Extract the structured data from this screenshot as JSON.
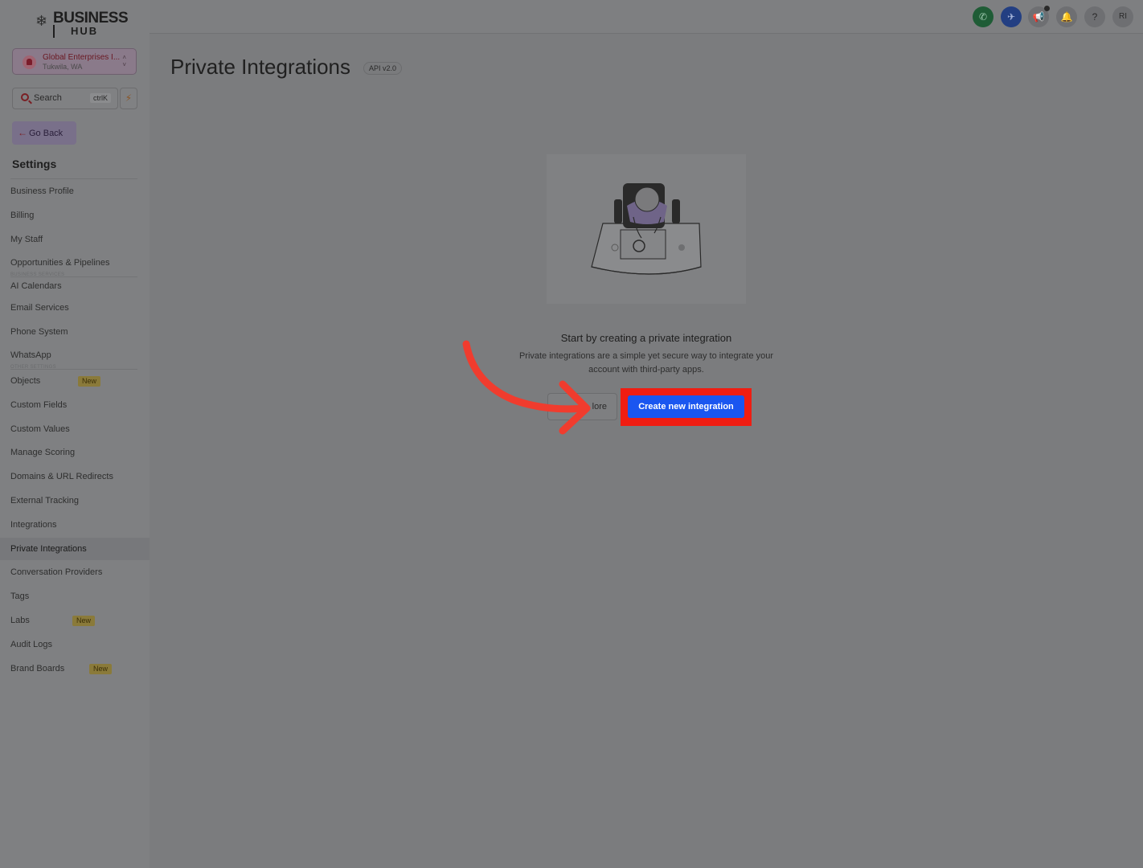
{
  "brand": {
    "line1": "BUSINESS",
    "line2": "HUB"
  },
  "account": {
    "name": "Global Enterprises I...",
    "location": "Tukwila, WA"
  },
  "search": {
    "label": "Search",
    "shortcut": "ctrlK"
  },
  "go_back": "Go Back",
  "settings_title": "Settings",
  "sections": {
    "business_services": "BUSINESS SERVICES",
    "other_settings": "OTHER SETTINGS"
  },
  "nav": [
    {
      "label": "Business Profile"
    },
    {
      "label": "Billing"
    },
    {
      "label": "My Staff"
    },
    {
      "label": "Opportunities & Pipelines"
    },
    {
      "label": "AI Calendars"
    },
    {
      "label": "Email Services"
    },
    {
      "label": "Phone System"
    },
    {
      "label": "WhatsApp"
    },
    {
      "label": "Objects",
      "badge": "New"
    },
    {
      "label": "Custom Fields"
    },
    {
      "label": "Custom Values"
    },
    {
      "label": "Manage Scoring"
    },
    {
      "label": "Domains & URL Redirects"
    },
    {
      "label": "External Tracking"
    },
    {
      "label": "Integrations"
    },
    {
      "label": "Private Integrations",
      "active": true
    },
    {
      "label": "Conversation Providers"
    },
    {
      "label": "Tags"
    },
    {
      "label": "Labs",
      "badge": "New"
    },
    {
      "label": "Audit Logs"
    },
    {
      "label": "Brand Boards",
      "badge": "New"
    }
  ],
  "topbar": {
    "avatar_initials": "RI",
    "help": "?"
  },
  "page": {
    "title": "Private Integrations",
    "api_badge": "API v2.0",
    "empty_title": "Start by creating a private integration",
    "empty_desc": "Private integrations are a simple yet secure way to integrate your account with third-party apps.",
    "learn_more": "Learn More",
    "learn_more_visible": "lore",
    "create_button": "Create new integration"
  },
  "colors": {
    "primary": "#1a56f0",
    "highlight": "#f01d12",
    "arrow": "#f03c2e"
  }
}
